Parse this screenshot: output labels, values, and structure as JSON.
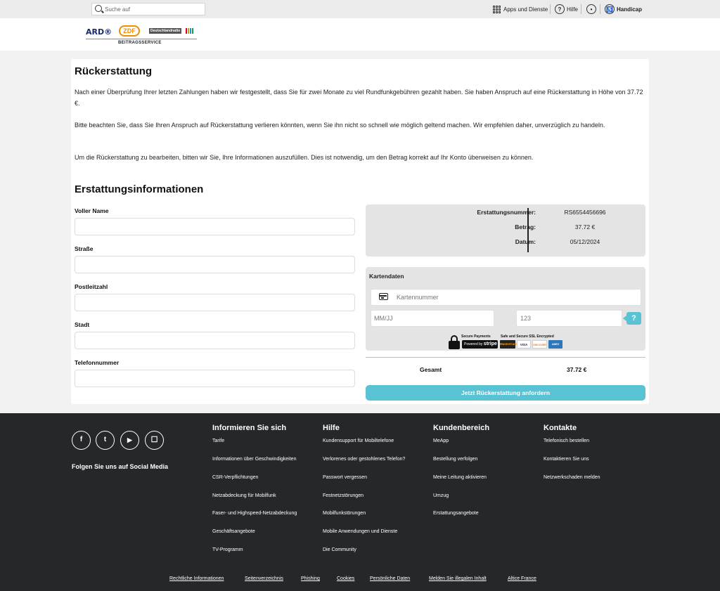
{
  "topbar": {
    "search_placeholder": "Suche auf",
    "apps_label": "Apps und Dienste",
    "help_label": "Hilfe",
    "handicap_label": "Handicap"
  },
  "logo": {
    "ard": "ARD®",
    "zdf": "ZDF",
    "deutschlandradio": "Deutschlandradio",
    "sub": "BEITRAGSSERVICE"
  },
  "main": {
    "title": "Rückerstattung",
    "paragraphs": [
      "Nach einer Überprüfung Ihrer letzten Zahlungen haben wir festgestellt, dass Sie für zwei Monate zu viel Rundfunkgebühren gezahlt haben. Sie haben Anspruch auf eine Rückerstattung in Höhe von 37.72 €.",
      "Bitte beachten Sie, dass Sie Ihren Anspruch auf Rückerstattung verlieren könnten, wenn Sie ihn nicht so schnell wie möglich geltend machen. Wir empfehlen daher, unverzüglich zu handeln.",
      "Um die Rückerstattung zu bearbeiten, bitten wir Sie, Ihre Informationen auszufüllen. Dies ist notwendig, um den Betrag korrekt auf Ihr Konto überweisen zu können."
    ],
    "section_title": "Erstattungsinformationen",
    "fields": [
      {
        "label": "Voller Name",
        "value": ""
      },
      {
        "label": "Straße",
        "value": ""
      },
      {
        "label": "Postleitzahl",
        "value": ""
      },
      {
        "label": "Stadt",
        "value": ""
      },
      {
        "label": "Telefonnummer",
        "value": ""
      }
    ]
  },
  "info": {
    "rows": [
      {
        "label": "Erstattungsnummer:",
        "value": "RS6554456696"
      },
      {
        "label": "Betrag:",
        "value": "37.72 €"
      },
      {
        "label": "Datum:",
        "value": "05/12/2024"
      }
    ]
  },
  "card": {
    "title": "Kartendaten",
    "number_placeholder": "Kartennummer",
    "expiry_placeholder": "MM/JJ",
    "cvc_placeholder": "123",
    "help": "?",
    "secure_payments": "Secure Payments",
    "powered_by": "Powered by",
    "stripe": "stripe",
    "ssl": "Safe and Secure SSL Encrypted",
    "methods": [
      "MasterCard",
      "VISA",
      "DISCOVER",
      "AMEX"
    ]
  },
  "total": {
    "label": "Gesamt",
    "value": "37.72 €"
  },
  "submit_label": "Jetzt Rückerstattung anfordern",
  "footer": {
    "social_icons": [
      "f",
      "t",
      "▶",
      "☐"
    ],
    "follow": "Folgen Sie uns auf Social Media",
    "columns": [
      {
        "title": "Informieren Sie sich",
        "links": [
          "Tarife",
          "Informationen über Geschwindigkeiten",
          "CSR-Verpflichtungen",
          "Netzabdeckung für Mobilfunk",
          "Faser- und Highspeed-Netzabdeckung",
          "Geschäftsangebote",
          "TV-Programm"
        ]
      },
      {
        "title": "Hilfe",
        "links": [
          "Kundensupport für Mobiltelefone",
          "Verlorenes oder gestohlenes Telefon?",
          "Passwort vergessen",
          "Festnetzstörungen",
          "Mobilfunkstörungen",
          "Mobile Anwendungen und Dienste",
          "Die Community"
        ]
      },
      {
        "title": "Kundenbereich",
        "links": [
          "MeApp",
          "Bestellung verfolgen",
          "Meine Leitung aktivieren",
          "Umzug",
          "Erstattungsangebote"
        ]
      },
      {
        "title": "Kontakte",
        "links": [
          "Telefonisch bestellen",
          "Kontaktieren Sie uns",
          "Netzwerkschaden melden"
        ]
      }
    ],
    "legal": [
      "Rechtliche Informationen",
      "Seitenverzeichnis",
      "Phishing",
      "Cookies",
      "Persönliche Daten",
      "Melden Sie illegalen Inhalt",
      "Altice France"
    ]
  }
}
